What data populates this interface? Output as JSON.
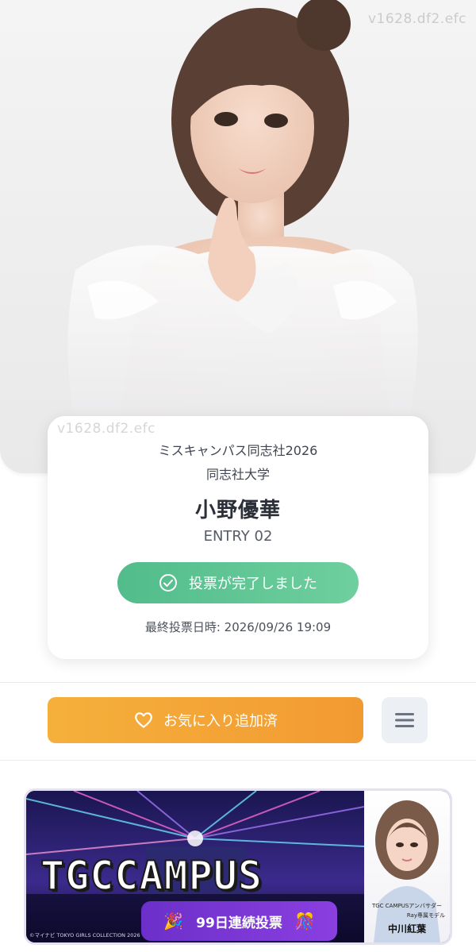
{
  "watermarks": {
    "top": "v1628.df2.efc",
    "card": "v1628.df2.efc"
  },
  "profile": {
    "contest": "ミスキャンパス同志社2026",
    "school": "同志社大学",
    "name": "小野優華",
    "entry": "ENTRY 02",
    "vote_status": "投票が完了しました",
    "last_vote": "最終投票日時: 2026/09/26 19:09"
  },
  "actions": {
    "favorite_label": "お気に入り追加済",
    "menu_icon": "hamburger-menu-icon"
  },
  "banner": {
    "logo": "TGCCAMPUS",
    "streak_label": "99日連続投票",
    "streak_icon_left": "🎉",
    "streak_icon_right": "🎊",
    "copyright": "©マイナビ TOKYO GIRLS COLLECTION 2026",
    "ambassador_title": "TGC CAMPUSアンバサダー",
    "ambassador_sub": "Ray専属モデル",
    "ambassador_name": "中川紅葉"
  },
  "colors": {
    "vote_green": "#52bc8b",
    "favorite_orange": "#f29a32",
    "streak_purple": "#7a36d6"
  }
}
